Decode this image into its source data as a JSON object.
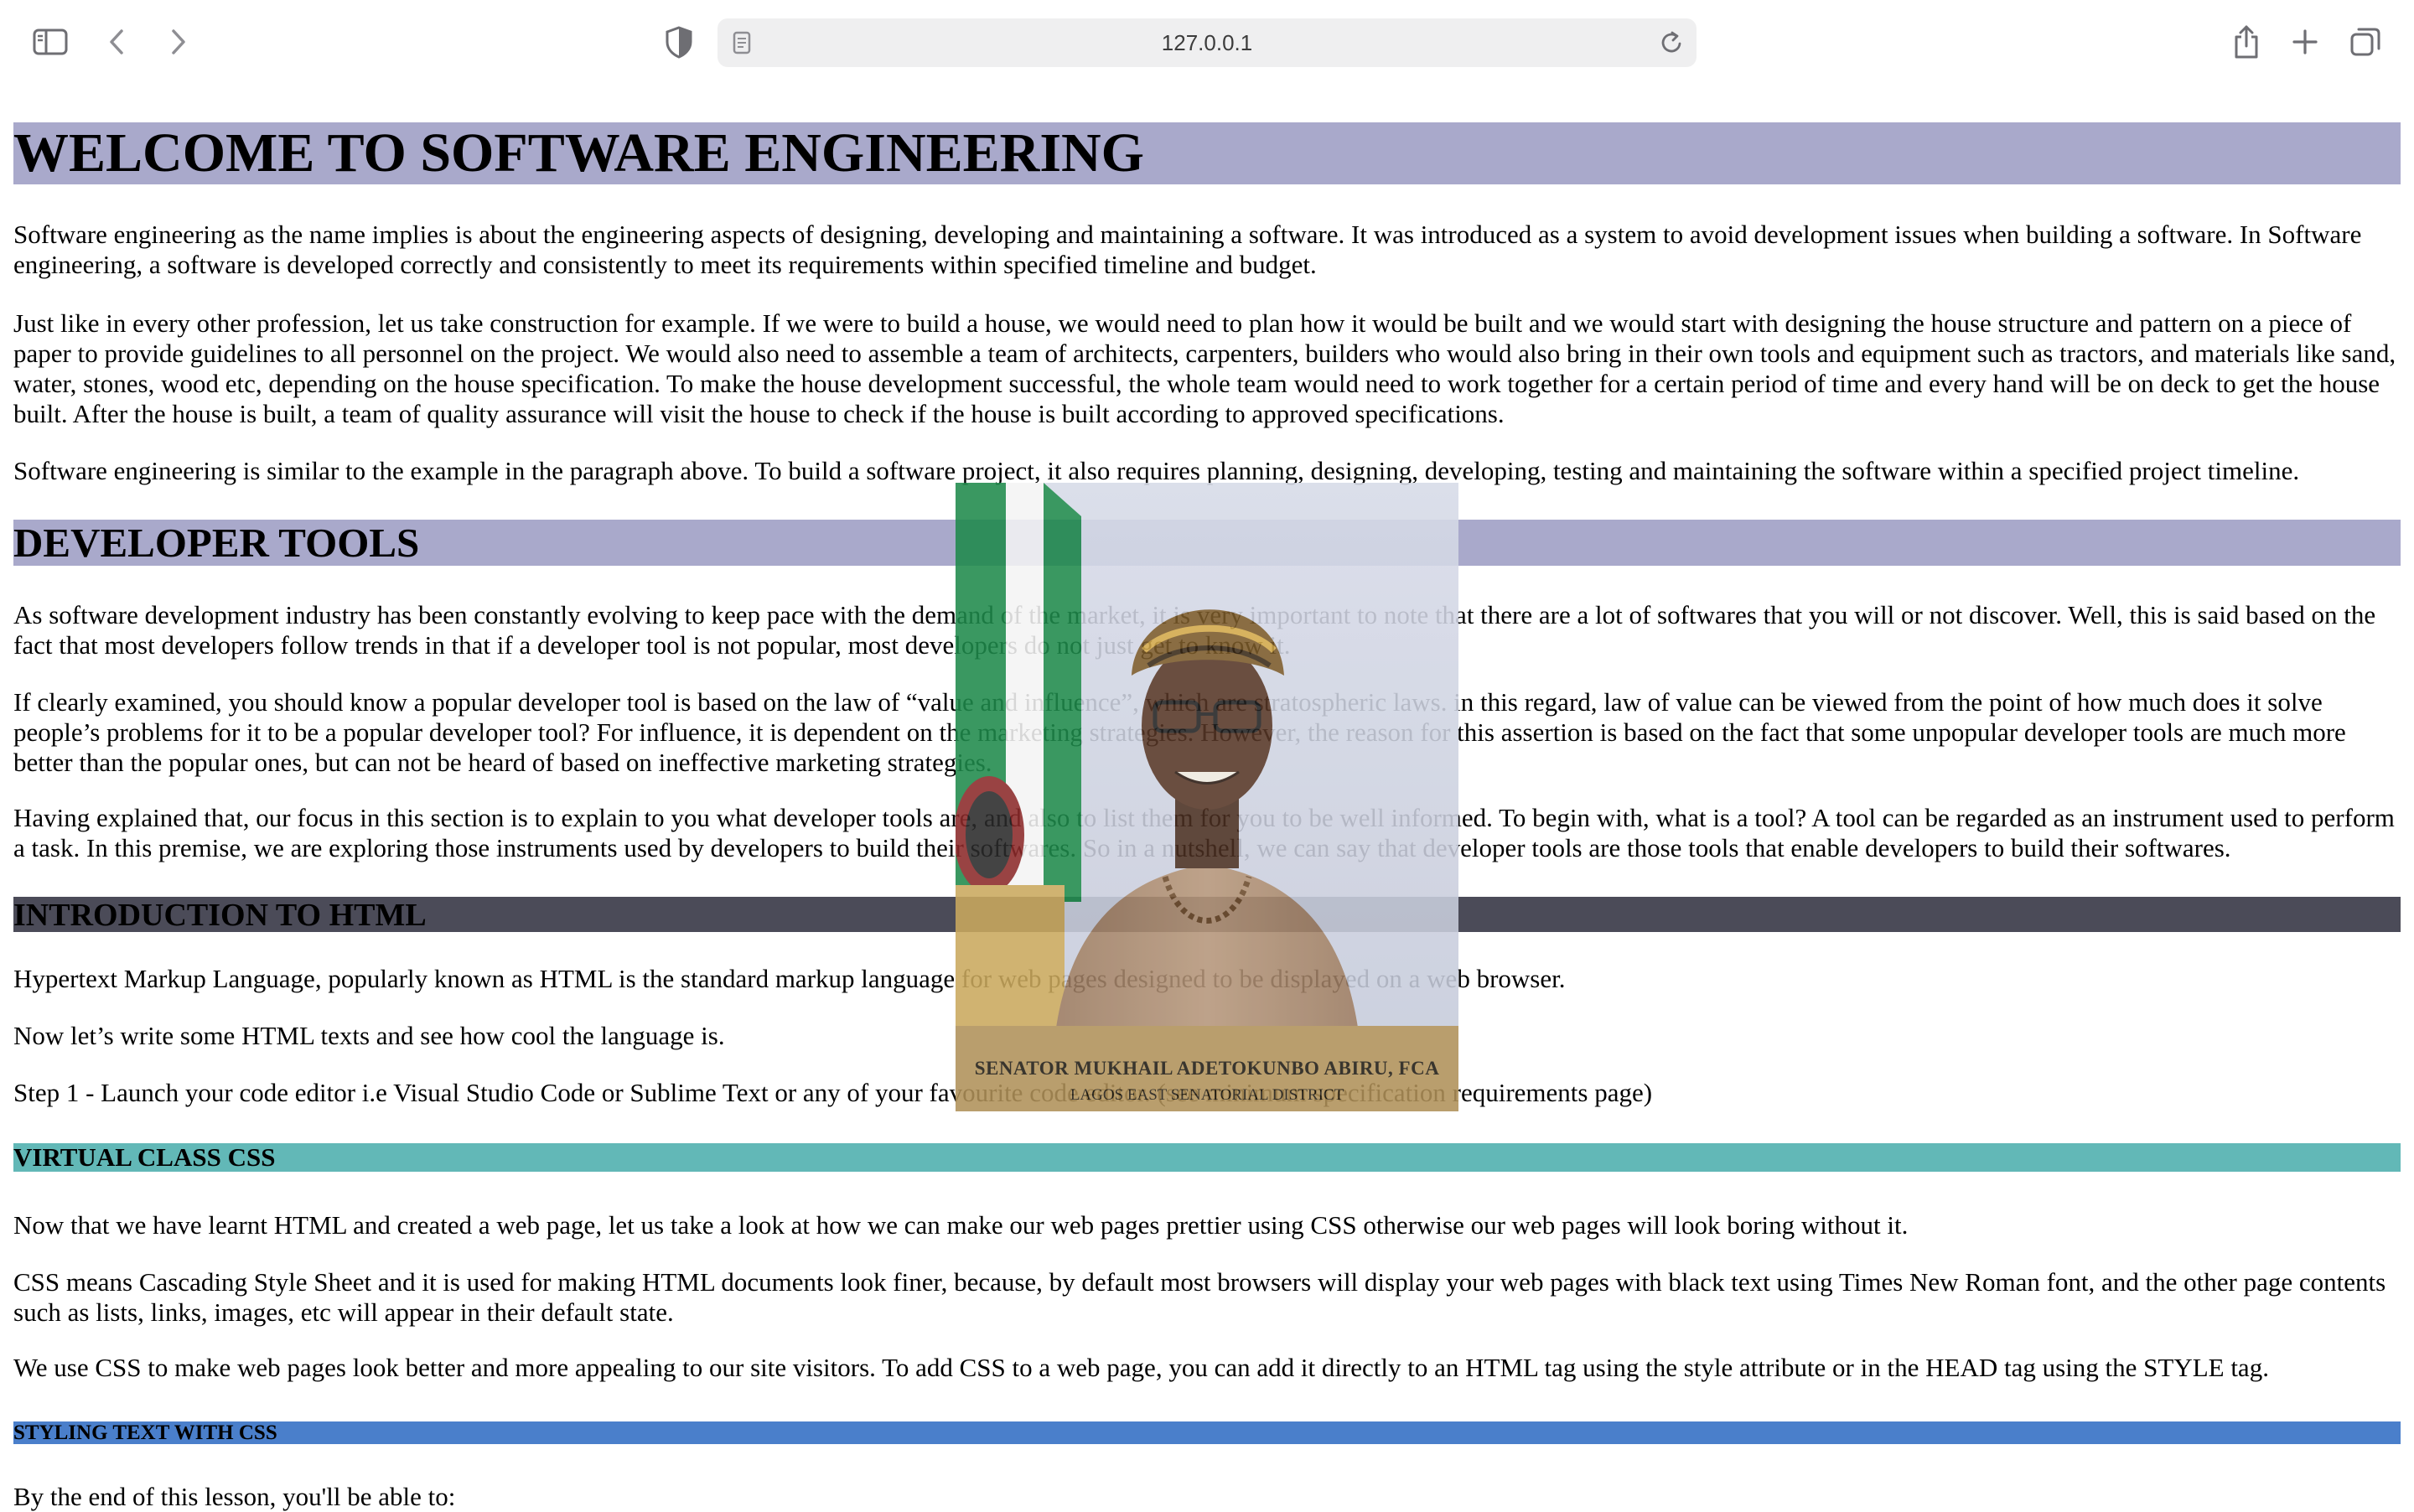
{
  "browser": {
    "url": "127.0.0.1",
    "icons": [
      "sidebar-icon",
      "back-icon",
      "forward-icon",
      "privacy-shield-icon",
      "page-icon",
      "reload-icon",
      "share-icon",
      "new-tab-icon",
      "tab-overview-icon"
    ]
  },
  "content": {
    "heading_welcome": "WELCOME TO SOFTWARE ENGINEERING",
    "p1": "Software engineering as the name implies is about the engineering aspects of designing, developing and maintaining a software. It was introduced as a system to avoid development issues when building a software. In Software engineering, a software is developed correctly and consistently to meet its requirements within specified timeline and budget.",
    "p2": "Just like in every other profession, let us take construction for example. If we were to build a house, we would need to plan how it would be built and we would start with designing the house structure and pattern on a piece of paper to provide guidelines to all personnel on the project. We would also need to assemble a team of architects, carpenters, builders who would also bring in their own tools and equipment such as tractors, and materials like sand, water, stones, wood etc, depending on the house specification. To make the house development successful, the whole team would need to work together for a certain period of time and every hand will be on deck to get the house built. After the house is built, a team of quality assurance will visit the house to check if the house is built according to approved specifications.",
    "p3": "Software engineering is similar to the example in the paragraph above. To build a software project, it also requires planning, designing, developing, testing and maintaining the software within a specified project timeline.",
    "heading_devtools": "DEVELOPER TOOLS",
    "p4": "As software development industry has been constantly evolving to keep pace with the demand of the market, it is very important to note that there are a lot of softwares that you will or not discover. Well, this is said based on the fact that most developers follow trends in that if a developer tool is not popular, most developers do not just get to know it.",
    "p5": "If clearly examined, you should know a popular developer tool is based on the law of “value and influence”, which are stratospheric laws. in this regard, law of value can be viewed from the point of how much does it solve people’s problems for it to be a popular developer tool? For influence, it is dependent on the marketing strategies. However, the reason for this assertion is based on the fact that some unpopular developer tools are much more better than the popular ones, but can not be heard of based on ineffective marketing strategies.",
    "p6": "Having explained that, our focus in this section is to explain to you what developer tools are, and also to list them for you to be well informed. To begin with, what is a tool? A tool can be regarded as an instrument used to perform a task. In this premise, we are exploring those instruments used by developers to build their softwares. So in a nutshell, we can say that developer tools are those tools that enable developers to build their softwares.",
    "heading_html": "INTRODUCTION TO HTML",
    "p7": "Hypertext Markup Language, popularly known as HTML is the standard markup language for web pages designed to be displayed on a web browser.",
    "p8": "Now let’s write some HTML texts and see how cool the language is.",
    "p9": "Step 1 - Launch your code editor  i.e Visual Studio Code or Sublime Text or any of your favourite code editor. (see minimum specification requirements page)",
    "heading_vcss": "VIRTUAL CLASS CSS",
    "p10": "Now that we have learnt HTML and created a web page, let us take a look at how we can make our web pages prettier using CSS otherwise our web pages will look boring without it.",
    "p11": "CSS means Cascading Style Sheet and it is used for making HTML documents look finer, because, by default most browsers will display your web pages with black text using Times New Roman font, and the other page contents such as lists, links, images, etc will appear in their default state.",
    "p12": "We use CSS to make web pages look better and more appealing to our site visitors. To add CSS to a web page, you can add it directly to an HTML tag using the style attribute or in the HEAD tag using the STYLE tag.",
    "heading_styling": "STYLING TEXT WITH CSS",
    "p13": "By the end of this lesson, you'll be able to:"
  },
  "portrait": {
    "caption_name": "SENATOR MUKHAIL ADETOKUNBO ABIRU, FCA",
    "caption_district": "LAGOS EAST SENATORIAL DISTRICT"
  },
  "colors": {
    "heading_lavender": "#a9a9cb",
    "heading_dark": "#4b4b58",
    "heading_teal": "#62b8b7",
    "heading_blue": "#4a7fcb",
    "caption_gold": "#b09159"
  }
}
